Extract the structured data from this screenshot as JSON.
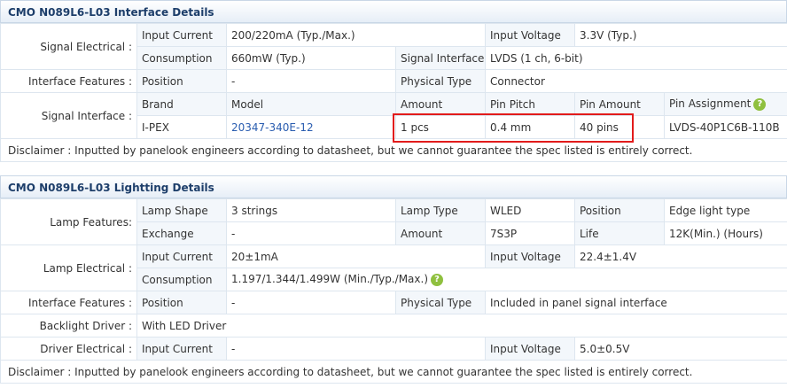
{
  "interface": {
    "title": "CMO N089L6-L03 Interface Details",
    "signal_electrical": {
      "label": "Signal Electrical :",
      "input_current_key": "Input Current",
      "input_current_val": "200/220mA (Typ./Max.)",
      "input_voltage_key": "Input Voltage",
      "input_voltage_val": "3.3V (Typ.)",
      "consumption_key": "Consumption",
      "consumption_val": "660mW (Typ.)",
      "signal_interface_key": "Signal Interface",
      "signal_interface_val": "LVDS (1 ch, 6-bit)"
    },
    "interface_features": {
      "label": "Interface Features :",
      "position_key": "Position",
      "position_val": "-",
      "physical_type_key": "Physical Type",
      "physical_type_val": "Connector"
    },
    "signal_interface": {
      "label": "Signal Interface :",
      "headers": [
        "Brand",
        "Model",
        "Amount",
        "Pin Pitch",
        "Pin Amount",
        "Pin Assignment"
      ],
      "values": [
        "I-PEX",
        "20347-340E-12",
        "1 pcs",
        "0.4 mm",
        "40 pins",
        "LVDS-40P1C6B-110B"
      ]
    },
    "disclaimer": "Disclaimer : Inputted by panelook engineers according to datasheet, but we cannot guarantee the spec listed is entirely correct."
  },
  "lighting": {
    "title": "CMO N089L6-L03 Lightting Details",
    "lamp_features": {
      "label": "Lamp Features:",
      "lamp_shape_key": "Lamp Shape",
      "lamp_shape_val": "3 strings",
      "lamp_type_key": "Lamp Type",
      "lamp_type_val": "WLED",
      "position_key": "Position",
      "position_val": "Edge light type",
      "exchange_key": "Exchange",
      "exchange_val": "-",
      "amount_key": "Amount",
      "amount_val": "7S3P",
      "life_key": "Life",
      "life_val": "12K(Min.) (Hours)"
    },
    "lamp_electrical": {
      "label": "Lamp Electrical :",
      "input_current_key": "Input Current",
      "input_current_val": "20±1mA",
      "input_voltage_key": "Input Voltage",
      "input_voltage_val": "22.4±1.4V",
      "consumption_key": "Consumption",
      "consumption_val": "1.197/1.344/1.499W (Min./Typ./Max.)"
    },
    "interface_features": {
      "label": "Interface Features :",
      "position_key": "Position",
      "position_val": "-",
      "physical_type_key": "Physical Type",
      "physical_type_val": "Included in panel signal interface"
    },
    "backlight_driver": {
      "label": "Backlight Driver :",
      "val": "With LED Driver"
    },
    "driver_electrical": {
      "label": "Driver Electrical :",
      "input_current_key": "Input Current",
      "input_current_val": "-",
      "input_voltage_key": "Input Voltage",
      "input_voltage_val": "5.0±0.5V"
    },
    "disclaimer": "Disclaimer : Inputted by panelook engineers according to datasheet, but we cannot guarantee the spec listed is entirely correct."
  },
  "help_icon_glyph": "?"
}
